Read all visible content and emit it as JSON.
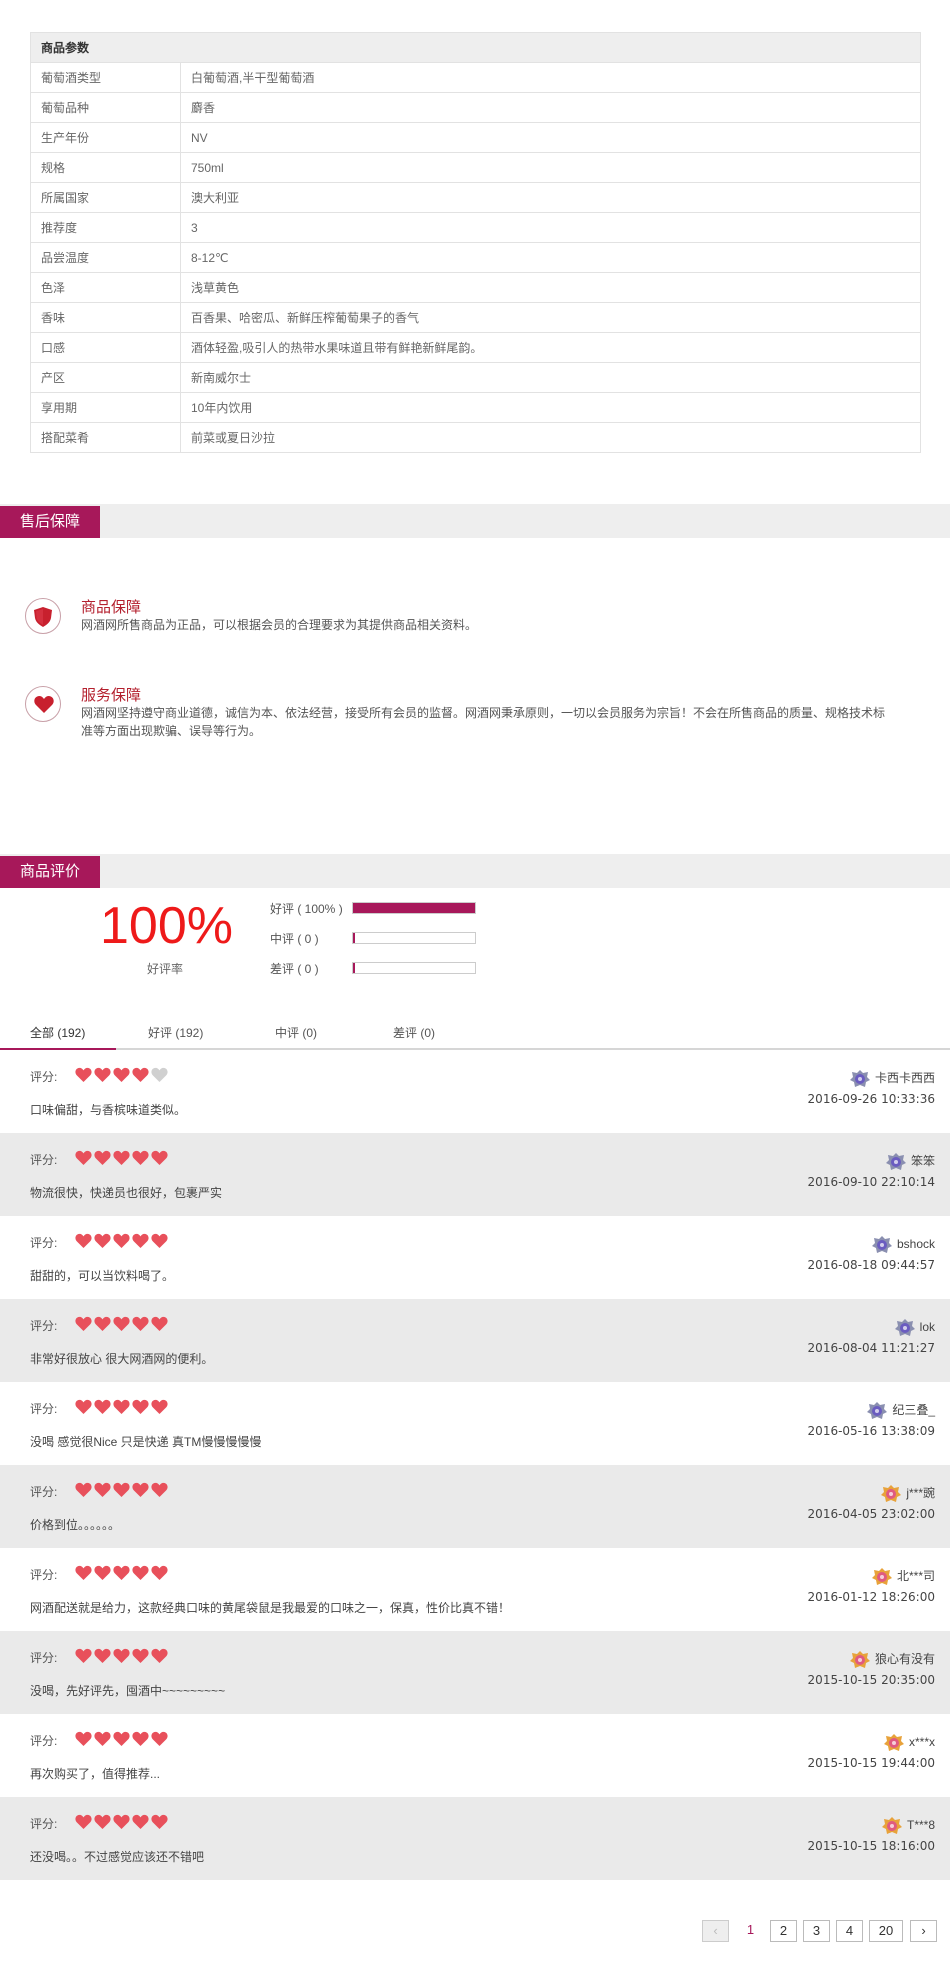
{
  "params": {
    "header": "商品参数",
    "rows": [
      {
        "k": "葡萄酒类型",
        "v": "白葡萄酒,半干型葡萄酒"
      },
      {
        "k": "葡萄品种",
        "v": "麝香"
      },
      {
        "k": "生产年份",
        "v": "NV"
      },
      {
        "k": "规格",
        "v": "750ml"
      },
      {
        "k": "所属国家",
        "v": "澳大利亚"
      },
      {
        "k": "推荐度",
        "v": "3"
      },
      {
        "k": "品尝温度",
        "v": "8-12℃"
      },
      {
        "k": "色泽",
        "v": "浅草黄色"
      },
      {
        "k": "香味",
        "v": "百香果、哈密瓜、新鲜压榨葡萄果子的香气"
      },
      {
        "k": "口感",
        "v": "酒体轻盈,吸引人的热带水果味道且带有鲜艳新鲜尾韵。"
      },
      {
        "k": "产区",
        "v": "新南威尔士"
      },
      {
        "k": "享用期",
        "v": "10年内饮用"
      },
      {
        "k": "搭配菜肴",
        "v": "前菜或夏日沙拉"
      }
    ]
  },
  "after_sales": {
    "tab": "售后保障",
    "items": [
      {
        "title": "商品保障",
        "desc": "网酒网所售商品为正品，可以根据会员的合理要求为其提供商品相关资料。",
        "icon": "shield-icon"
      },
      {
        "title": "服务保障",
        "desc": "网酒网坚持遵守商业道德，诚信为本、依法经营，接受所有会员的监督。网酒网秉承原则，一切以会员服务为宗旨！不会在所售商品的质量、规格技术标准等方面出现欺骗、误导等行为。",
        "icon": "heart-icon"
      }
    ]
  },
  "reviews": {
    "tab": "商品评价",
    "summary": {
      "percent": "100%",
      "label": "好评率"
    },
    "ratings": [
      {
        "label": "好评 ( 100% )",
        "fraction": 1.0
      },
      {
        "label": "中评 ( 0 )",
        "fraction": 0
      },
      {
        "label": "差评 ( 0 )",
        "fraction": 0
      }
    ],
    "filter_tabs": [
      "全部 (192)",
      "好评 (192)",
      "中评 (0)",
      "差评 (0)"
    ],
    "score_label": "评分:",
    "items": [
      {
        "hearts": 4,
        "text": "口味偏甜，与香槟味道类似。",
        "user": "卡西卡西西",
        "time": "2016-09-26 10:33:36",
        "badge": "silver"
      },
      {
        "hearts": 5,
        "text": "物流很快，快递员也很好，包裹严实",
        "user": "笨笨",
        "time": "2016-09-10 22:10:14",
        "badge": "silver"
      },
      {
        "hearts": 5,
        "text": "甜甜的，可以当饮料喝了。",
        "user": "bshock",
        "time": "2016-08-18 09:44:57",
        "badge": "silver"
      },
      {
        "hearts": 5,
        "text": "非常好很放心 很大网酒网的便利。",
        "user": "lok",
        "time": "2016-08-04 11:21:27",
        "badge": "silver"
      },
      {
        "hearts": 5,
        "text": "没喝 感觉很Nice 只是快递 真TM慢慢慢慢慢",
        "user": "纪三叠_",
        "time": "2016-05-16 13:38:09",
        "badge": "silver"
      },
      {
        "hearts": 5,
        "text": "价格到位。。。。。。",
        "user": "j***豌",
        "time": "2016-04-05 23:02:00",
        "badge": "gold"
      },
      {
        "hearts": 5,
        "text": "网酒配送就是给力，这款经典口味的黄尾袋鼠是我最爱的口味之一，保真，性价比真不错！",
        "user": "北***司",
        "time": "2016-01-12 18:26:00",
        "badge": "gold"
      },
      {
        "hearts": 5,
        "text": "没喝，先好评先，囤酒中~~~~~~~~~",
        "user": "狼心有没有",
        "time": "2015-10-15 20:35:00",
        "badge": "gold"
      },
      {
        "hearts": 5,
        "text": "再次购买了，值得推荐...",
        "user": "x***x",
        "time": "2015-10-15 19:44:00",
        "badge": "gold"
      },
      {
        "hearts": 5,
        "text": "还没喝。。不过感觉应该还不错吧",
        "user": "T***8",
        "time": "2015-10-15 18:16:00",
        "badge": "gold"
      }
    ]
  },
  "pager": {
    "prev": "‹",
    "pages": [
      "1",
      "2",
      "3",
      "4",
      "20"
    ],
    "current": "1",
    "next": "›"
  },
  "colors": {
    "accent": "#a7185a",
    "heart": "#e8505b",
    "heart_empty": "#d0d0d0",
    "percent": "#ee1a1a"
  }
}
